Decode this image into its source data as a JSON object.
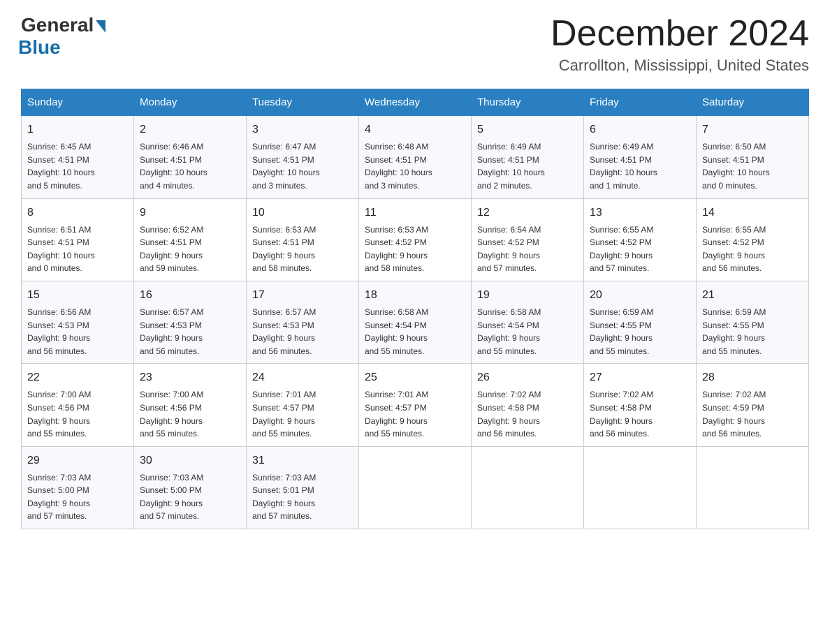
{
  "header": {
    "logo_general": "General",
    "logo_blue": "Blue",
    "month_title": "December 2024",
    "location": "Carrollton, Mississippi, United States"
  },
  "weekdays": [
    "Sunday",
    "Monday",
    "Tuesday",
    "Wednesday",
    "Thursday",
    "Friday",
    "Saturday"
  ],
  "weeks": [
    [
      {
        "day": "1",
        "sunrise": "6:45 AM",
        "sunset": "4:51 PM",
        "daylight": "10 hours and 5 minutes."
      },
      {
        "day": "2",
        "sunrise": "6:46 AM",
        "sunset": "4:51 PM",
        "daylight": "10 hours and 4 minutes."
      },
      {
        "day": "3",
        "sunrise": "6:47 AM",
        "sunset": "4:51 PM",
        "daylight": "10 hours and 3 minutes."
      },
      {
        "day": "4",
        "sunrise": "6:48 AM",
        "sunset": "4:51 PM",
        "daylight": "10 hours and 3 minutes."
      },
      {
        "day": "5",
        "sunrise": "6:49 AM",
        "sunset": "4:51 PM",
        "daylight": "10 hours and 2 minutes."
      },
      {
        "day": "6",
        "sunrise": "6:49 AM",
        "sunset": "4:51 PM",
        "daylight": "10 hours and 1 minute."
      },
      {
        "day": "7",
        "sunrise": "6:50 AM",
        "sunset": "4:51 PM",
        "daylight": "10 hours and 0 minutes."
      }
    ],
    [
      {
        "day": "8",
        "sunrise": "6:51 AM",
        "sunset": "4:51 PM",
        "daylight": "10 hours and 0 minutes."
      },
      {
        "day": "9",
        "sunrise": "6:52 AM",
        "sunset": "4:51 PM",
        "daylight": "9 hours and 59 minutes."
      },
      {
        "day": "10",
        "sunrise": "6:53 AM",
        "sunset": "4:51 PM",
        "daylight": "9 hours and 58 minutes."
      },
      {
        "day": "11",
        "sunrise": "6:53 AM",
        "sunset": "4:52 PM",
        "daylight": "9 hours and 58 minutes."
      },
      {
        "day": "12",
        "sunrise": "6:54 AM",
        "sunset": "4:52 PM",
        "daylight": "9 hours and 57 minutes."
      },
      {
        "day": "13",
        "sunrise": "6:55 AM",
        "sunset": "4:52 PM",
        "daylight": "9 hours and 57 minutes."
      },
      {
        "day": "14",
        "sunrise": "6:55 AM",
        "sunset": "4:52 PM",
        "daylight": "9 hours and 56 minutes."
      }
    ],
    [
      {
        "day": "15",
        "sunrise": "6:56 AM",
        "sunset": "4:53 PM",
        "daylight": "9 hours and 56 minutes."
      },
      {
        "day": "16",
        "sunrise": "6:57 AM",
        "sunset": "4:53 PM",
        "daylight": "9 hours and 56 minutes."
      },
      {
        "day": "17",
        "sunrise": "6:57 AM",
        "sunset": "4:53 PM",
        "daylight": "9 hours and 56 minutes."
      },
      {
        "day": "18",
        "sunrise": "6:58 AM",
        "sunset": "4:54 PM",
        "daylight": "9 hours and 55 minutes."
      },
      {
        "day": "19",
        "sunrise": "6:58 AM",
        "sunset": "4:54 PM",
        "daylight": "9 hours and 55 minutes."
      },
      {
        "day": "20",
        "sunrise": "6:59 AM",
        "sunset": "4:55 PM",
        "daylight": "9 hours and 55 minutes."
      },
      {
        "day": "21",
        "sunrise": "6:59 AM",
        "sunset": "4:55 PM",
        "daylight": "9 hours and 55 minutes."
      }
    ],
    [
      {
        "day": "22",
        "sunrise": "7:00 AM",
        "sunset": "4:56 PM",
        "daylight": "9 hours and 55 minutes."
      },
      {
        "day": "23",
        "sunrise": "7:00 AM",
        "sunset": "4:56 PM",
        "daylight": "9 hours and 55 minutes."
      },
      {
        "day": "24",
        "sunrise": "7:01 AM",
        "sunset": "4:57 PM",
        "daylight": "9 hours and 55 minutes."
      },
      {
        "day": "25",
        "sunrise": "7:01 AM",
        "sunset": "4:57 PM",
        "daylight": "9 hours and 55 minutes."
      },
      {
        "day": "26",
        "sunrise": "7:02 AM",
        "sunset": "4:58 PM",
        "daylight": "9 hours and 56 minutes."
      },
      {
        "day": "27",
        "sunrise": "7:02 AM",
        "sunset": "4:58 PM",
        "daylight": "9 hours and 56 minutes."
      },
      {
        "day": "28",
        "sunrise": "7:02 AM",
        "sunset": "4:59 PM",
        "daylight": "9 hours and 56 minutes."
      }
    ],
    [
      {
        "day": "29",
        "sunrise": "7:03 AM",
        "sunset": "5:00 PM",
        "daylight": "9 hours and 57 minutes."
      },
      {
        "day": "30",
        "sunrise": "7:03 AM",
        "sunset": "5:00 PM",
        "daylight": "9 hours and 57 minutes."
      },
      {
        "day": "31",
        "sunrise": "7:03 AM",
        "sunset": "5:01 PM",
        "daylight": "9 hours and 57 minutes."
      },
      null,
      null,
      null,
      null
    ]
  ],
  "labels": {
    "sunrise": "Sunrise:",
    "sunset": "Sunset:",
    "daylight": "Daylight:"
  }
}
